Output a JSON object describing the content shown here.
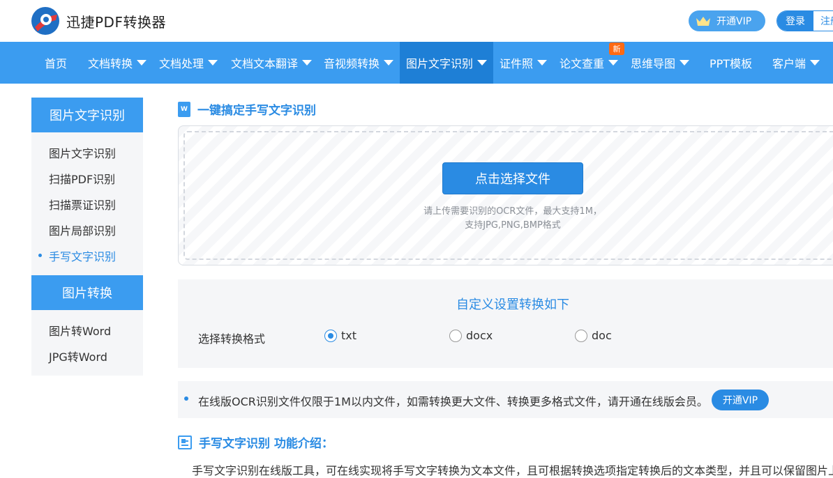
{
  "header": {
    "brand": "迅捷PDF转换器",
    "vip_label": "开通VIP",
    "login_label": "登录",
    "register_label": "注册"
  },
  "nav": {
    "items": [
      {
        "label": "首页",
        "dropdown": false
      },
      {
        "label": "文档转换",
        "dropdown": true
      },
      {
        "label": "文档处理",
        "dropdown": true
      },
      {
        "label": "文档文本翻译",
        "dropdown": true
      },
      {
        "label": "音视频转换",
        "dropdown": true
      },
      {
        "label": "图片文字识别",
        "dropdown": true,
        "active": true
      },
      {
        "label": "证件照",
        "dropdown": true
      },
      {
        "label": "论文查重",
        "dropdown": true
      },
      {
        "label": "思维导图",
        "dropdown": true
      },
      {
        "label": "PPT模板",
        "dropdown": false
      },
      {
        "label": "客户端",
        "dropdown": true
      }
    ],
    "new_badge": "新"
  },
  "sidebar": {
    "group1_title": "图片文字识别",
    "group1_items": [
      "图片文字识别",
      "扫描PDF识别",
      "扫描票证识别",
      "图片局部识别",
      "手写文字识别"
    ],
    "group2_title": "图片转换",
    "group2_items": [
      "图片转Word",
      "JPG转Word"
    ]
  },
  "main": {
    "section_title": "一键搞定手写文字识别",
    "doc_icon_letter": "W",
    "upload_button": "点击选择文件",
    "upload_hint_line1": "请上传需要识别的OCR文件，最大支持1M，",
    "upload_hint_line2": "支持JPG,PNG,BMP格式",
    "settings_title": "自定义设置转换如下",
    "format_label": "选择转换格式",
    "format_options": [
      "txt",
      "docx",
      "doc"
    ],
    "selected_format": "txt",
    "notice_text": "在线版OCR识别文件仅限于1M以内文件，如需转换更大文件、转换更多格式文件，请开通在线版会员。",
    "notice_vip": "开通VIP",
    "intro_title": "手写文字识别 功能介绍：",
    "intro_text": "手写文字识别在线版工具，可在线实现将手写文字转换为文本文件，且可根据转换选项指定转换后的文本类型，并且可以保留图片上"
  },
  "colors": {
    "primary": "#3b9cf0",
    "active_nav": "#1e7fd6",
    "accent": "#2a8be3",
    "badge": "#ff6a13"
  }
}
